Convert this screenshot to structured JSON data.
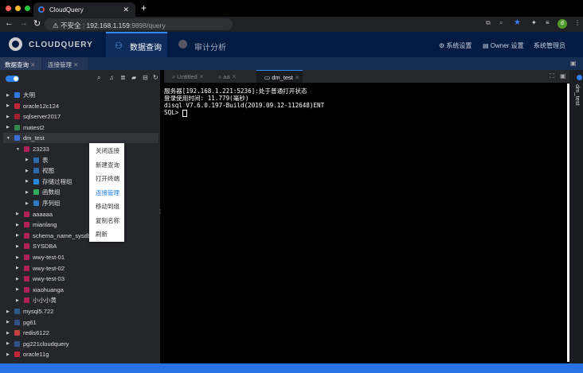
{
  "browser": {
    "tab_title": "CloudQuery",
    "url_host": "192.168.1.159",
    "url_rest": ":9898/query",
    "insecure_label": "不安全",
    "profile_initial": "d"
  },
  "app": {
    "logo": "CLOUDQUERY",
    "nav": [
      {
        "label": "数据查询"
      },
      {
        "label": "审计分析"
      }
    ],
    "header_right": {
      "settings": "系统设置",
      "owner": "Owner 设置",
      "admin": "系统管理员"
    }
  },
  "subtabs": [
    {
      "label": "数据查询"
    },
    {
      "label": "连接管理"
    }
  ],
  "tree": [
    {
      "label": "大明",
      "level": 0,
      "color": "#2d7be0",
      "open": false
    },
    {
      "label": "oracle12c124",
      "level": 0,
      "color": "#c0283a",
      "open": false
    },
    {
      "label": "sqlserver2017",
      "level": 0,
      "color": "#a02030",
      "open": false
    },
    {
      "label": "matest2",
      "level": 0,
      "color": "#2e8a4e",
      "open": false
    },
    {
      "label": "dm_test",
      "level": 0,
      "color": "#3a6fd8",
      "open": true,
      "selected": true
    },
    {
      "label": "23233",
      "level": 1,
      "color": "#b0205a",
      "open": true
    },
    {
      "label": "表",
      "level": 2,
      "color": "#2b6cb0",
      "open": false
    },
    {
      "label": "视图",
      "level": 2,
      "color": "#2b6cb0",
      "open": false
    },
    {
      "label": "存储过程组",
      "level": 2,
      "color": "#2b8ad8",
      "open": false
    },
    {
      "label": "函数组",
      "level": 2,
      "color": "#2eaa5a",
      "open": false
    },
    {
      "label": "序列组",
      "level": 2,
      "color": "#2b7ac8",
      "open": false
    },
    {
      "label": "aaaaaa",
      "level": 1,
      "color": "#b0205a",
      "open": false
    },
    {
      "label": "mianlang",
      "level": 1,
      "color": "#b0205a",
      "open": false
    },
    {
      "label": "schema_name_sysdba",
      "level": 1,
      "color": "#b0205a",
      "open": false
    },
    {
      "label": "SYSDBA",
      "level": 1,
      "color": "#b0205a",
      "open": false
    },
    {
      "label": "wwy-test-01",
      "level": 1,
      "color": "#b0205a",
      "open": false
    },
    {
      "label": "wwy-test-02",
      "level": 1,
      "color": "#b0205a",
      "open": false
    },
    {
      "label": "wwy-test-03",
      "level": 1,
      "color": "#b0205a",
      "open": false
    },
    {
      "label": "xiaohuanga",
      "level": 1,
      "color": "#b0205a",
      "open": false
    },
    {
      "label": "小小小黄",
      "level": 1,
      "color": "#b0205a",
      "open": false
    },
    {
      "label": "mysql5.722",
      "level": 0,
      "color": "#2e5c8a",
      "open": false
    },
    {
      "label": "pg61",
      "level": 0,
      "color": "#34508a",
      "open": false
    },
    {
      "label": "redis6122",
      "level": 0,
      "color": "#c04040",
      "open": false
    },
    {
      "label": "pg221cloudquery",
      "level": 0,
      "color": "#34508a",
      "open": false
    },
    {
      "label": "oracle11g",
      "level": 0,
      "color": "#c0283a",
      "open": false
    }
  ],
  "context_menu": [
    {
      "label": "关闭连接"
    },
    {
      "label": "新建查询"
    },
    {
      "label": "打开终端"
    },
    {
      "label": "连接管理",
      "active": true
    },
    {
      "label": "移动到组"
    },
    {
      "label": "复制名称"
    },
    {
      "label": "刷新"
    }
  ],
  "editor_tabs": [
    {
      "label": "Untitled"
    },
    {
      "label": "aa"
    },
    {
      "label": "dm_test",
      "active": true
    }
  ],
  "terminal": [
    "服务器[192.168.1.221:5236]:处于普通打开状态",
    "登录使用时间: 11.779(毫秒)",
    "disql V7.6.0.197-Build(2019.09.12-112648)ENT",
    "SQL> "
  ],
  "right_panel": {
    "label": "dm_test"
  }
}
